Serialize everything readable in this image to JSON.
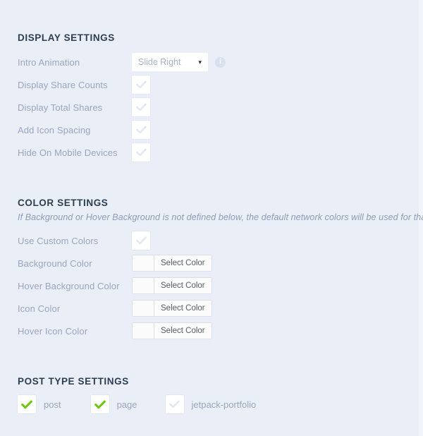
{
  "page": {
    "background_color": "#eaeef7"
  },
  "display_settings": {
    "title": "DISPLAY SETTINGS",
    "intro_animation": {
      "label": "Intro Animation",
      "value": "Slide Right",
      "arrow": "▾",
      "info_glyph": "i"
    },
    "toggles": [
      {
        "label": "Display Share Counts",
        "checked": false
      },
      {
        "label": "Display Total Shares",
        "checked": false
      },
      {
        "label": "Add Icon Spacing",
        "checked": false
      },
      {
        "label": "Hide On Mobile Devices",
        "checked": false
      }
    ]
  },
  "color_settings": {
    "title": "COLOR SETTINGS",
    "description": "If Background or Hover Background is not defined below, the default network colors will be used for that element.",
    "use_custom_colors": {
      "label": "Use Custom Colors",
      "checked": false
    },
    "color_rows": [
      {
        "label": "Background Color",
        "button_label": "Select Color",
        "swatch": ""
      },
      {
        "label": "Hover Background Color",
        "button_label": "Select Color",
        "swatch": ""
      },
      {
        "label": "Icon Color",
        "button_label": "Select Color",
        "swatch": ""
      },
      {
        "label": "Hover Icon Color",
        "button_label": "Select Color",
        "swatch": ""
      }
    ]
  },
  "post_type_settings": {
    "title": "POST TYPE SETTINGS",
    "items": [
      {
        "label": "post",
        "checked": true
      },
      {
        "label": "page",
        "checked": true
      },
      {
        "label": "jetpack-portfolio",
        "checked": false
      }
    ]
  },
  "colors": {
    "check_on": "#6ec70a",
    "check_off": "#e2e7f2",
    "heading": "#2c3e50",
    "label": "#9aa6bd"
  }
}
